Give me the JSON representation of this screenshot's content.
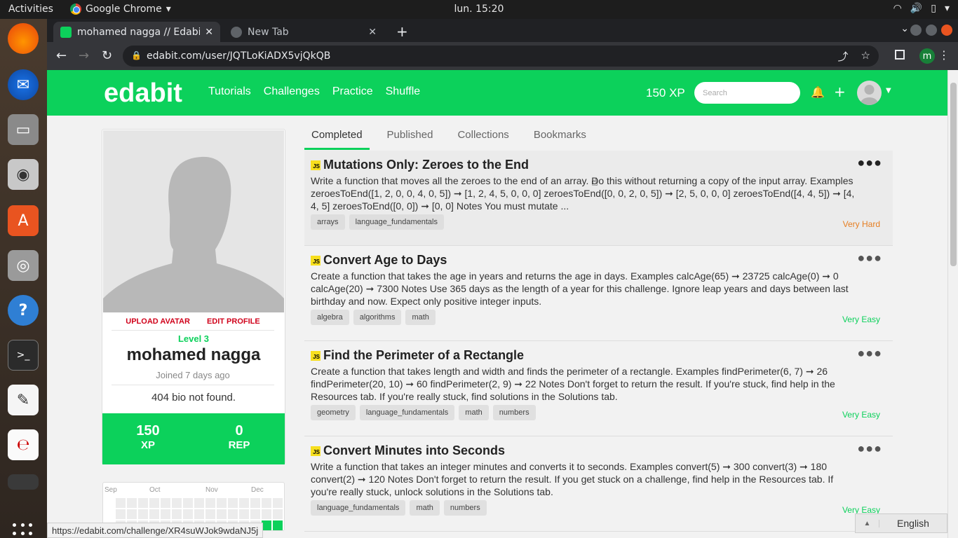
{
  "os": {
    "activities": "Activities",
    "app_name": "Google Chrome",
    "clock": "lun. 15:20"
  },
  "browser": {
    "tabs": [
      {
        "label": "mohamed nagga // Edabit"
      },
      {
        "label": "New Tab"
      }
    ],
    "url": "edabit.com/user/JQTLoKiADX5vjQkQB",
    "profile_initial": "m",
    "status_url": "https://edabit.com/challenge/XR4suWJok9wdaNJ5j"
  },
  "site": {
    "logo": "edabit",
    "nav": [
      "Tutorials",
      "Challenges",
      "Practice",
      "Shuffle"
    ],
    "xp": "150 XP",
    "search_placeholder": "Search"
  },
  "profile": {
    "upload_avatar": "UPLOAD AVATAR",
    "edit_profile": "EDIT PROFILE",
    "level": "Level 3",
    "username": "mohamed nagga",
    "joined": "Joined 7 days ago",
    "bio": "404 bio not found.",
    "xp_value": "150",
    "xp_label": "XP",
    "rep_value": "0",
    "rep_label": "REP",
    "calendar_months": [
      "Sep",
      "Oct",
      "Nov",
      "Dec"
    ]
  },
  "profile_tabs": [
    "Completed",
    "Published",
    "Collections",
    "Bookmarks"
  ],
  "challenges": [
    {
      "badge": "JS",
      "title": "Mutations Only: Zeroes to the End",
      "description": "Write a function that moves all the zeroes to the end of an array. Do this without returning a copy of the input array. Examples zeroesToEnd([1, 2, 0, 0, 4, 0, 5]) ➞ [1, 2, 4, 5, 0, 0, 0] zeroesToEnd([0, 0, 2, 0, 5]) ➞ [2, 5, 0, 0, 0] zeroesToEnd([4, 4, 5]) ➞ [4, 4, 5] zeroesToEnd([0, 0]) ➞ [0, 0] Notes You must mutate ...",
      "tags": [
        "arrays",
        "language_fundamentals"
      ],
      "difficulty": "Very Hard",
      "difficulty_color": "#e67e22"
    },
    {
      "badge": "JS",
      "title": "Convert Age to Days",
      "description": "Create a function that takes the age in years and returns the age in days. Examples calcAge(65) ➞ 23725 calcAge(0) ➞ 0 calcAge(20) ➞ 7300 Notes Use 365 days as the length of a year for this challenge. Ignore leap years and days between last birthday and now. Expect only positive integer inputs.",
      "tags": [
        "algebra",
        "algorithms",
        "math"
      ],
      "difficulty": "Very Easy",
      "difficulty_color": "#0cd15b"
    },
    {
      "badge": "JS",
      "title": "Find the Perimeter of a Rectangle",
      "description": "Create a function that takes length and width and finds the perimeter of a rectangle. Examples findPerimeter(6, 7) ➞ 26 findPerimeter(20, 10) ➞ 60 findPerimeter(2, 9) ➞ 22 Notes Don't forget to return the result. If you're stuck, find help in the Resources tab. If you're really stuck, find solutions in the Solutions tab.",
      "tags": [
        "geometry",
        "language_fundamentals",
        "math",
        "numbers"
      ],
      "difficulty": "Very Easy",
      "difficulty_color": "#0cd15b"
    },
    {
      "badge": "JS",
      "title": "Convert Minutes into Seconds",
      "description": "Write a function that takes an integer minutes and converts it to seconds. Examples convert(5) ➞ 300 convert(3) ➞ 180 convert(2) ➞ 120 Notes Don't forget to return the result. If you get stuck on a challenge, find help in the Resources tab. If you're really stuck, unlock solutions in the Solutions tab.",
      "tags": [
        "language_fundamentals",
        "math",
        "numbers"
      ],
      "difficulty": "Very Easy",
      "difficulty_color": "#0cd15b"
    }
  ],
  "language": "English",
  "colors": {
    "brand": "#0cd15b"
  }
}
